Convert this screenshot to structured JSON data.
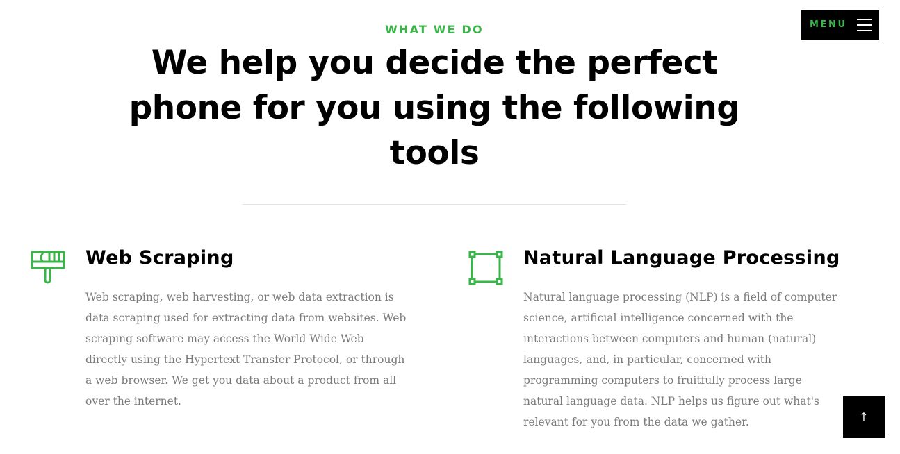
{
  "header": {
    "eyebrow": "WHAT WE DO",
    "headline": "We help you decide the perfect phone for you using the following tools"
  },
  "nav": {
    "menu_label": "MENU",
    "menu_icon": "hamburger-icon"
  },
  "features": [
    {
      "icon": "paintbrush-icon",
      "title": "Web Scraping",
      "text": "Web scraping, web harvesting, or web data extraction is data scraping used for extracting data from websites. Web scraping software may access the World Wide Web directly using the Hypertext Transfer Protocol, or through a web browser. We get you data about a product from all over the internet."
    },
    {
      "icon": "vector-square-icon",
      "title": "Natural Language Processing",
      "text": "Natural language processing (NLP) is a field of computer science, artificial intelligence concerned with the interactions between computers and human (natural) languages, and, in particular, concerned with programming computers to fruitfully process large natural language data. NLP helps us figure out what's relevant for you from the data we gather."
    }
  ],
  "back_to_top": {
    "icon": "arrow-up-icon",
    "glyph": "↑"
  },
  "colors": {
    "accent": "#3ab54a",
    "text_muted": "#7a7a7a",
    "button_bg": "#000000"
  }
}
